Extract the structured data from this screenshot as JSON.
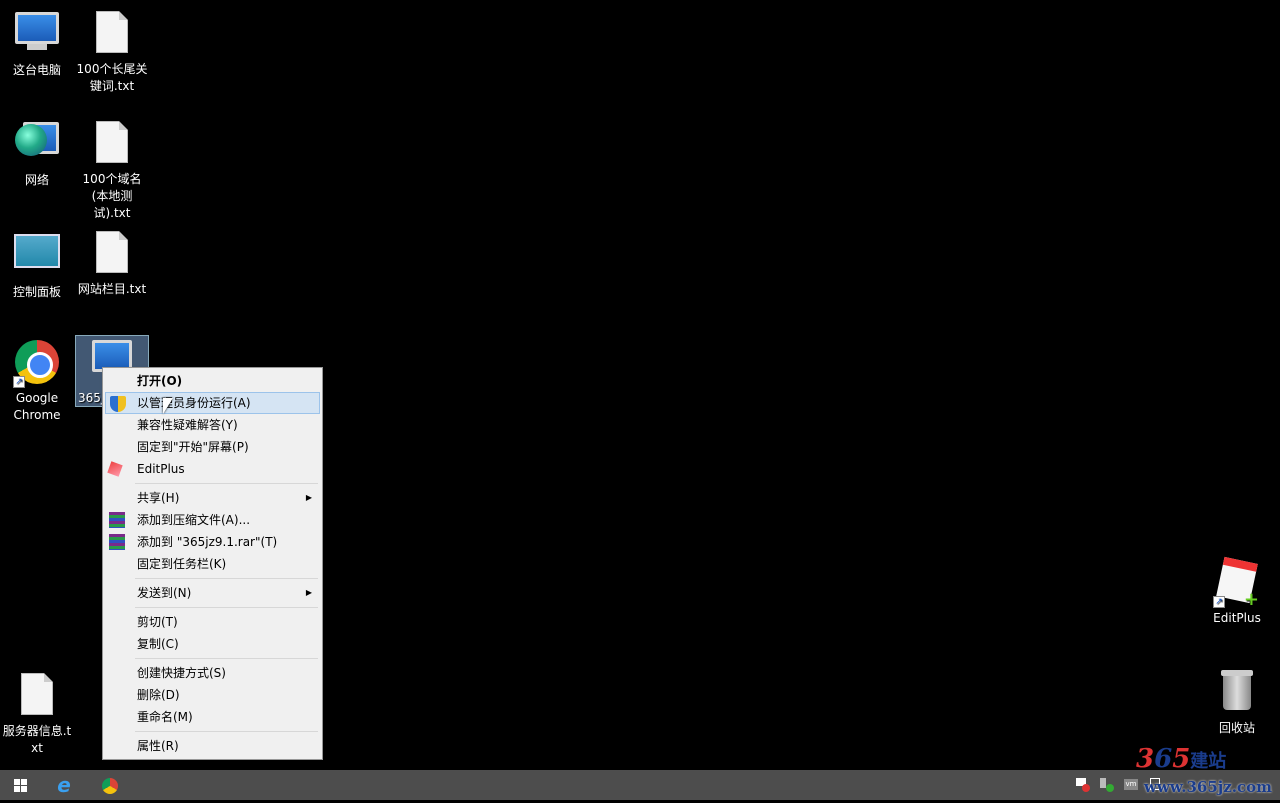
{
  "desktop": {
    "icons": [
      {
        "label": "这台电脑",
        "kind": "computer-icon"
      },
      {
        "label": "100个长尾关键词.txt",
        "kind": "text-file-icon"
      },
      {
        "label": "网络",
        "kind": "network-icon"
      },
      {
        "label": "100个域名(本地测试).txt",
        "kind": "text-file-icon"
      },
      {
        "label": "控制面板",
        "kind": "control-panel-icon"
      },
      {
        "label": "网站栏目.txt",
        "kind": "text-file-icon"
      },
      {
        "label": "Google Chrome",
        "kind": "chrome-icon"
      },
      {
        "label": "365jz9.1",
        "kind": "application-icon"
      },
      {
        "label": "服务器信息.txt",
        "kind": "text-file-icon"
      },
      {
        "label": "EditPlus",
        "kind": "editplus-icon"
      },
      {
        "label": "回收站",
        "kind": "recycle-bin-icon"
      }
    ]
  },
  "context_menu": {
    "items": [
      {
        "label": "打开(O)"
      },
      {
        "label": "以管理员身份运行(A)"
      },
      {
        "label": "兼容性疑难解答(Y)"
      },
      {
        "label": "固定到\"开始\"屏幕(P)"
      },
      {
        "label": "EditPlus"
      },
      {
        "label": "共享(H)"
      },
      {
        "label": "添加到压缩文件(A)..."
      },
      {
        "label": "添加到 \"365jz9.1.rar\"(T)"
      },
      {
        "label": "固定到任务栏(K)"
      },
      {
        "label": "发送到(N)"
      },
      {
        "label": "剪切(T)"
      },
      {
        "label": "复制(C)"
      },
      {
        "label": "创建快捷方式(S)"
      },
      {
        "label": "删除(D)"
      },
      {
        "label": "重命名(M)"
      },
      {
        "label": "属性(R)"
      }
    ]
  },
  "watermark": {
    "brand": "365建站",
    "url": "www.365jz.com"
  },
  "colors": {
    "taskbar": "#4d4d4d",
    "menu_highlight": "#d5e4f3"
  }
}
